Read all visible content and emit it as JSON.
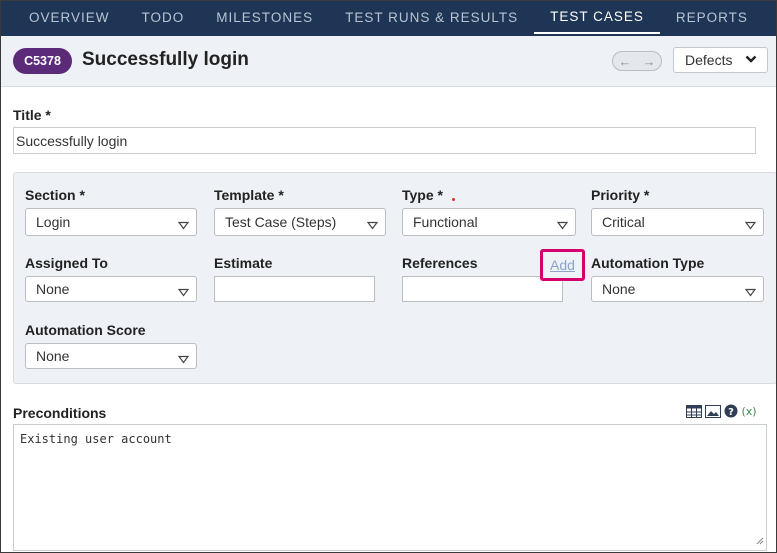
{
  "nav": {
    "tabs": [
      {
        "label": "OVERVIEW"
      },
      {
        "label": "TODO"
      },
      {
        "label": "MILESTONES"
      },
      {
        "label": "TEST RUNS & RESULTS"
      },
      {
        "label": "TEST CASES",
        "active": true
      },
      {
        "label": "REPORTS"
      }
    ]
  },
  "header": {
    "case_id": "C5378",
    "case_title": "Successfully login",
    "defects_label": "Defects"
  },
  "form": {
    "title_label": "Title *",
    "title_value": "Successfully login",
    "section_label": "Section *",
    "section_value": "Login",
    "template_label": "Template *",
    "template_value": "Test Case (Steps)",
    "type_label": "Type *",
    "type_value": "Functional",
    "priority_label": "Priority *",
    "priority_value": "Critical",
    "assigned_label": "Assigned To",
    "assigned_value": "None",
    "estimate_label": "Estimate",
    "estimate_value": "",
    "references_label": "References",
    "references_value": "",
    "references_add": "Add",
    "automation_type_label": "Automation Type",
    "automation_type_value": "None",
    "automation_score_label": "Automation Score",
    "automation_score_value": "None",
    "preconditions_label": "Preconditions",
    "preconditions_value": "Existing user account"
  },
  "colors": {
    "nav_bg": "#1e3556",
    "badge_bg": "#5b2a79",
    "highlight": "#d4006f",
    "panel_bg": "#eef1f5"
  }
}
